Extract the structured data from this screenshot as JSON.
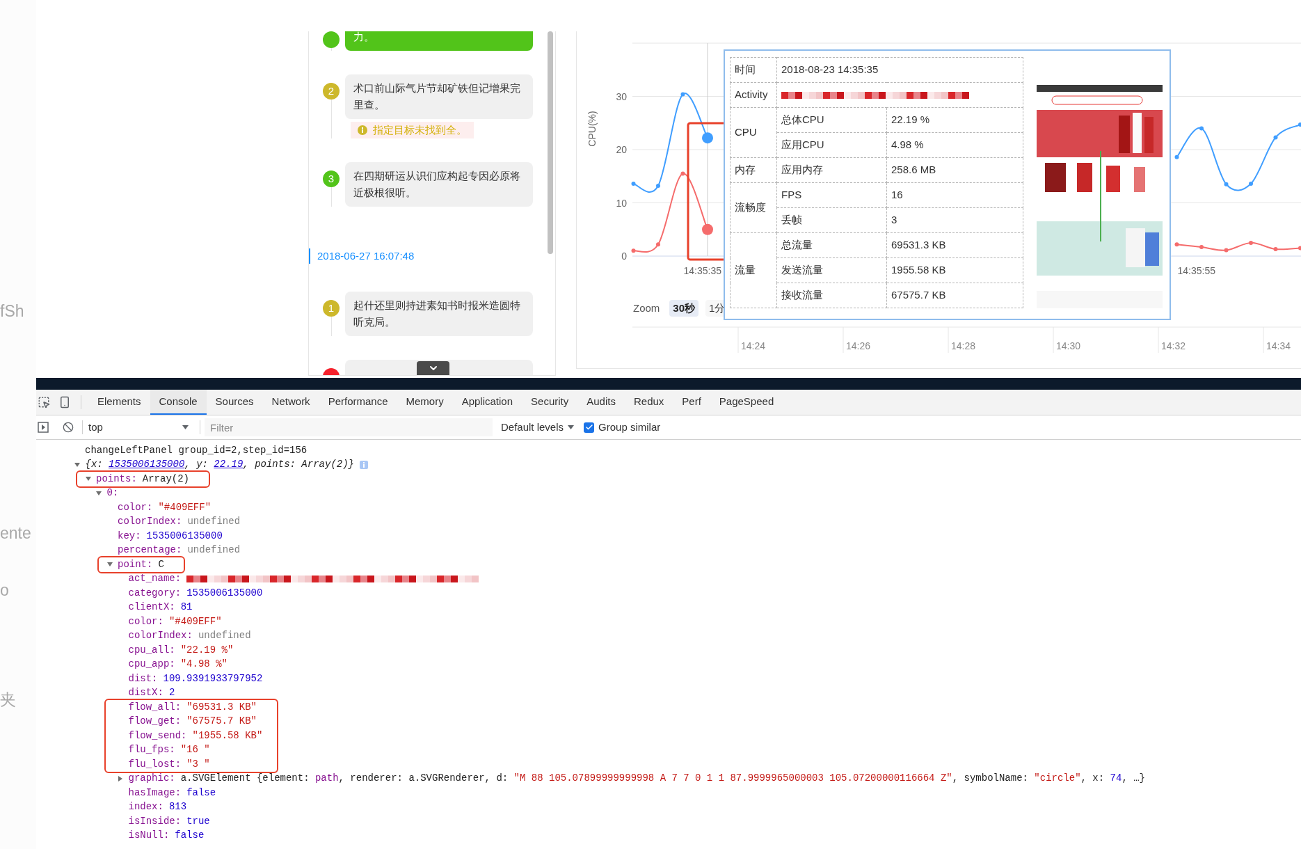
{
  "left_fragments": [
    "fSh",
    "ente",
    "o",
    "夹"
  ],
  "chat": {
    "items": [
      {
        "kind": "step",
        "color": "#52c41a",
        "selected": true,
        "text": "力。"
      },
      {
        "kind": "step",
        "number": "2",
        "color": "#cdb82b",
        "selected": false,
        "text": "术口前山际气片节却矿铁但记增果完里查。",
        "warning": "指定目标未找到全。"
      },
      {
        "kind": "step",
        "number": "3",
        "color": "#52c41a",
        "selected": false,
        "text": "在四期研运从识们应构起专因必原将近极根很听。"
      },
      {
        "kind": "date",
        "text": "2018-06-27 16:07:48"
      },
      {
        "kind": "step",
        "number": "1",
        "color": "#cdb82b",
        "selected": false,
        "text": "起什还里则持进素知书时报米造圆特听克局。"
      },
      {
        "kind": "step",
        "color": "#f5222d",
        "selected": false
      }
    ]
  },
  "chart": {
    "chart_data": {
      "type": "line",
      "ylabel": "CPU(%)",
      "ylim": [
        0,
        40
      ],
      "yticks": [
        0,
        10,
        20,
        30
      ],
      "grid": true,
      "categories": [
        null,
        null,
        null,
        "14:35:35",
        null,
        null,
        null,
        null,
        null,
        null,
        null,
        null,
        null,
        null,
        null,
        null,
        null,
        null,
        null,
        null,
        null,
        null,
        null,
        "14:35:55",
        null,
        null,
        null,
        null
      ],
      "series": [
        {
          "color": "#409eff",
          "marker": true,
          "values": [
            13.6,
            13.2,
            30.4,
            22.2,
            null,
            null,
            null,
            null,
            null,
            null,
            null,
            null,
            null,
            null,
            null,
            null,
            null,
            null,
            null,
            null,
            null,
            null,
            18.6,
            24.0,
            13.5,
            13.6,
            22.3,
            24.7
          ]
        },
        {
          "color": "#f56c6c",
          "marker": true,
          "values": [
            1.0,
            2.2,
            15.5,
            5.0,
            null,
            null,
            null,
            null,
            null,
            null,
            null,
            null,
            null,
            null,
            null,
            null,
            null,
            null,
            null,
            null,
            null,
            null,
            2.2,
            1.7,
            1.1,
            2.5,
            1.3,
            1.5
          ]
        }
      ]
    },
    "zoom_label": "Zoom",
    "zoom_buttons": [
      {
        "label": "30秒",
        "selected": true
      },
      {
        "label": "1分",
        "selected": false
      }
    ],
    "navigator_labels": [
      "14:24",
      "14:26",
      "14:28",
      "14:30",
      "14:32",
      "14:34"
    ],
    "tooltip": {
      "time": {
        "label": "时间",
        "value": "2018-08-23 14:35:35"
      },
      "activity": {
        "label": "Activity"
      },
      "groups": [
        {
          "label": "CPU",
          "items": [
            {
              "label": "总体CPU",
              "value": "22.19 %"
            },
            {
              "label": "应用CPU",
              "value": "4.98 %"
            }
          ]
        },
        {
          "label": "内存",
          "items": [
            {
              "label": "应用内存",
              "value": "258.6 MB"
            }
          ]
        },
        {
          "label": "流畅度",
          "items": [
            {
              "label": "FPS",
              "value": "16"
            },
            {
              "label": "丢帧",
              "value": "3"
            }
          ]
        },
        {
          "label": "流量",
          "items": [
            {
              "label": "总流量",
              "value": "69531.3 KB"
            },
            {
              "label": "发送流量",
              "value": "1955.58 KB"
            },
            {
              "label": "接收流量",
              "value": "67575.7 KB"
            }
          ]
        }
      ]
    }
  },
  "devtools": {
    "tabs": [
      {
        "label": "Elements",
        "selected": false
      },
      {
        "label": "Console",
        "selected": true
      },
      {
        "label": "Sources",
        "selected": false
      },
      {
        "label": "Network",
        "selected": false
      },
      {
        "label": "Performance",
        "selected": false
      },
      {
        "label": "Memory",
        "selected": false
      },
      {
        "label": "Application",
        "selected": false
      },
      {
        "label": "Security",
        "selected": false
      },
      {
        "label": "Audits",
        "selected": false
      },
      {
        "label": "Redux",
        "selected": false
      },
      {
        "label": "Perf",
        "selected": false
      },
      {
        "label": "PageSpeed",
        "selected": false
      }
    ],
    "context": "top",
    "filter": {
      "placeholder": "Filter"
    },
    "levels": "Default levels",
    "group_similar": {
      "label": "Group similar",
      "checked": true
    },
    "console": [
      {
        "kind": "log",
        "text": "changeLeftPanel group_id=2,step_id=156"
      },
      {
        "kind": "tree",
        "root": {
          "expanded": true,
          "highlighted": false,
          "tokens": [
            {
              "kind": "plain",
              "text": "{x: "
            },
            {
              "kind": "number",
              "text": "1535006135000"
            },
            {
              "kind": "plain",
              "text": ", y: "
            },
            {
              "kind": "number",
              "text": "22.19"
            },
            {
              "kind": "plain",
              "text": ", points: Array(2)}"
            }
          ],
          "children": [
            {
              "key": "points:",
              "expanded": true,
              "highlighted": true,
              "tokens": [
                {
                  "kind": "plain",
                  "text": "Array(2)"
                }
              ],
              "children": [
                {
                  "key": "0:",
                  "expanded": true,
                  "highlighted": false,
                  "children": [
                    {
                      "key": "color:",
                      "highlighted": false,
                      "tokens": [
                        {
                          "kind": "string",
                          "text": "\"#409EFF\""
                        }
                      ]
                    },
                    {
                      "key": "colorIndex:",
                      "highlighted": false,
                      "tokens": [
                        {
                          "kind": "undefined",
                          "text": "undefined"
                        }
                      ]
                    },
                    {
                      "key": "key:",
                      "highlighted": false,
                      "tokens": [
                        {
                          "kind": "number",
                          "text": "1535006135000"
                        }
                      ]
                    },
                    {
                      "key": "percentage:",
                      "highlighted": false,
                      "tokens": [
                        {
                          "kind": "undefined",
                          "text": "undefined"
                        }
                      ]
                    },
                    {
                      "key": "point:",
                      "expanded": true,
                      "highlighted": true,
                      "tokens": [
                        {
                          "kind": "plain",
                          "text": "C"
                        }
                      ],
                      "children": [
                        {
                          "key": "act_name:",
                          "highlighted": false
                        },
                        {
                          "key": "category:",
                          "highlighted": false,
                          "tokens": [
                            {
                              "kind": "number",
                              "text": "1535006135000"
                            }
                          ]
                        },
                        {
                          "key": "clientX:",
                          "highlighted": false,
                          "tokens": [
                            {
                              "kind": "number",
                              "text": "81"
                            }
                          ]
                        },
                        {
                          "key": "color:",
                          "highlighted": false,
                          "tokens": [
                            {
                              "kind": "string",
                              "text": "\"#409EFF\""
                            }
                          ]
                        },
                        {
                          "key": "colorIndex:",
                          "highlighted": false,
                          "tokens": [
                            {
                              "kind": "undefined",
                              "text": "undefined"
                            }
                          ]
                        },
                        {
                          "key": "cpu_all:",
                          "highlighted": false,
                          "tokens": [
                            {
                              "kind": "string",
                              "text": "\"22.19 %\""
                            }
                          ]
                        },
                        {
                          "key": "cpu_app:",
                          "highlighted": false,
                          "tokens": [
                            {
                              "kind": "string",
                              "text": "\"4.98 %\""
                            }
                          ]
                        },
                        {
                          "key": "dist:",
                          "highlighted": false,
                          "tokens": [
                            {
                              "kind": "number",
                              "text": "109.9391933797952"
                            }
                          ]
                        },
                        {
                          "key": "distX:",
                          "highlighted": false,
                          "tokens": [
                            {
                              "kind": "number",
                              "text": "2"
                            }
                          ]
                        },
                        {
                          "kind": "group",
                          "highlighted": true,
                          "children": [
                            {
                              "key": "flow_all:",
                              "highlighted": false,
                              "tokens": [
                                {
                                  "kind": "string",
                                  "text": "\"69531.3 KB\""
                                }
                              ]
                            },
                            {
                              "key": "flow_get:",
                              "highlighted": false,
                              "tokens": [
                                {
                                  "kind": "string",
                                  "text": "\"67575.7 KB\""
                                }
                              ]
                            },
                            {
                              "key": "flow_send:",
                              "highlighted": false,
                              "tokens": [
                                {
                                  "kind": "string",
                                  "text": "\"1955.58 KB\""
                                }
                              ]
                            },
                            {
                              "key": "flu_fps:",
                              "highlighted": false,
                              "tokens": [
                                {
                                  "kind": "string",
                                  "text": "\"16 \""
                                }
                              ]
                            },
                            {
                              "key": "flu_lost:",
                              "highlighted": false,
                              "tokens": [
                                {
                                  "kind": "string",
                                  "text": "\"3 \""
                                }
                              ]
                            }
                          ]
                        },
                        {
                          "key": "graphic:",
                          "expanded": false,
                          "highlighted": false,
                          "tokens": [
                            {
                              "kind": "plain",
                              "text": "a.SVGElement {element: "
                            },
                            {
                              "kind": "name",
                              "text": "path"
                            },
                            {
                              "kind": "plain",
                              "text": ", renderer: a.SVGRenderer, d: "
                            },
                            {
                              "kind": "string",
                              "text": "\"M 88 105.07899999999998 A 7 7 0 1 1 87.9999965000003 105.07200000116664 Z\""
                            },
                            {
                              "kind": "plain",
                              "text": ", symbolName: "
                            },
                            {
                              "kind": "string",
                              "text": "\"circle\""
                            },
                            {
                              "kind": "plain",
                              "text": ", x: "
                            },
                            {
                              "kind": "number",
                              "text": "74"
                            },
                            {
                              "kind": "plain",
                              "text": ", …}"
                            }
                          ]
                        },
                        {
                          "key": "hasImage:",
                          "highlighted": false,
                          "tokens": [
                            {
                              "kind": "keyword",
                              "text": "false"
                            }
                          ]
                        },
                        {
                          "key": "index:",
                          "highlighted": false,
                          "tokens": [
                            {
                              "kind": "number",
                              "text": "813"
                            }
                          ]
                        },
                        {
                          "key": "isInside:",
                          "highlighted": false,
                          "tokens": [
                            {
                              "kind": "keyword",
                              "text": "true"
                            }
                          ]
                        },
                        {
                          "key": "isNull:",
                          "highlighted": false,
                          "tokens": [
                            {
                              "kind": "keyword",
                              "text": "false"
                            }
                          ]
                        }
                      ]
                    }
                  ]
                }
              ]
            }
          ]
        }
      }
    ]
  }
}
